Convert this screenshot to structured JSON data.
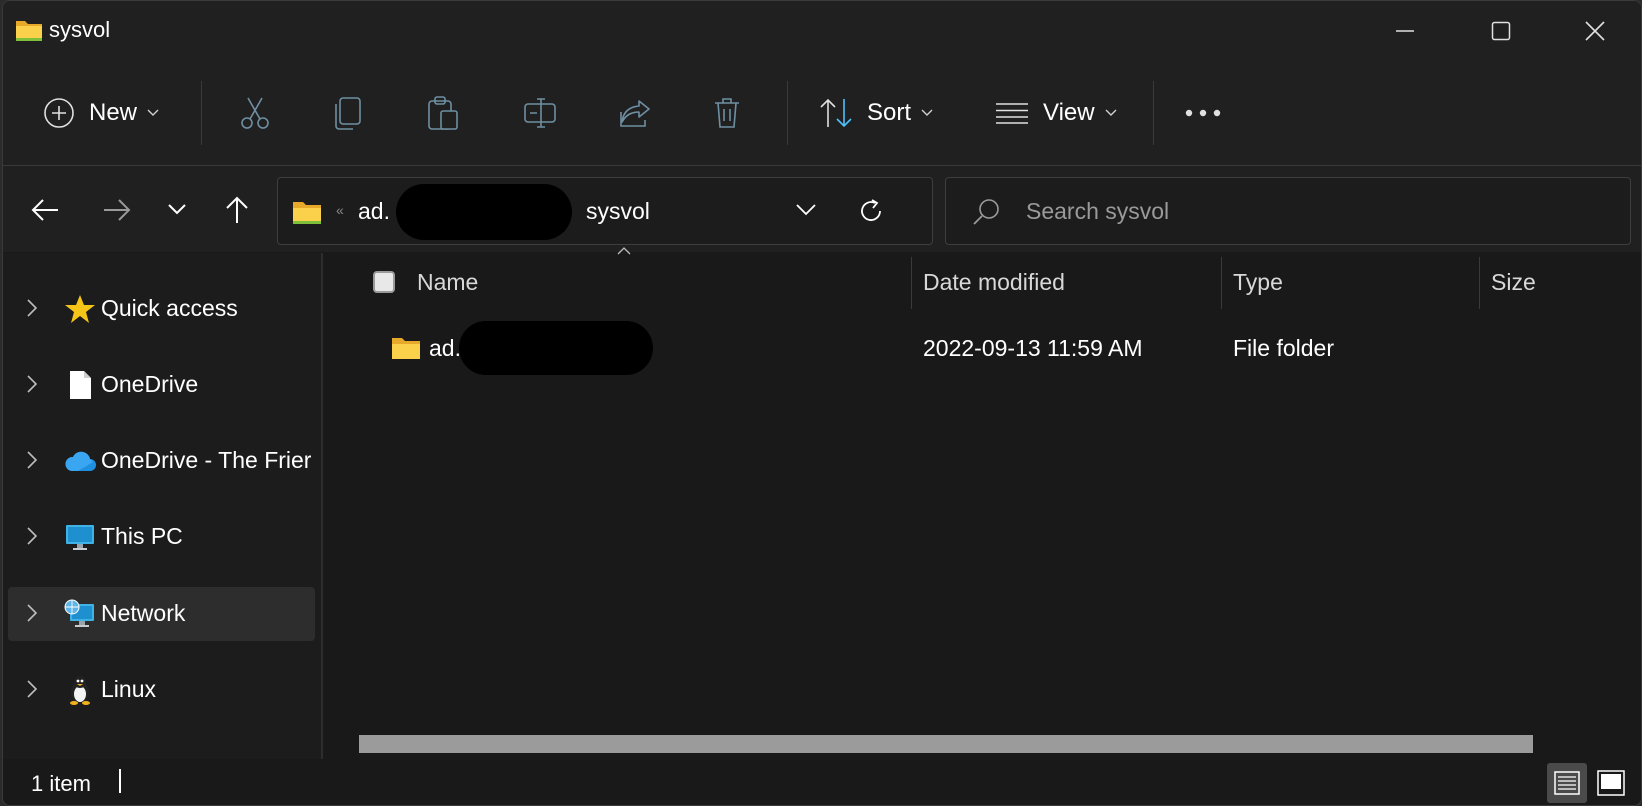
{
  "window": {
    "title": "sysvol",
    "controls": {
      "minimize": "minimize",
      "maximize": "maximize",
      "close": "close"
    }
  },
  "toolbar": {
    "new_label": "New",
    "sort_label": "Sort",
    "view_label": "View",
    "icons": [
      "plus-circle-icon",
      "cut-icon",
      "copy-icon",
      "paste-icon",
      "rename-icon",
      "share-icon",
      "delete-icon",
      "sort-icon",
      "view-icon",
      "more-icon"
    ]
  },
  "address": {
    "prefix": "ad.",
    "current": "sysvol",
    "separator": "«"
  },
  "search": {
    "placeholder": "Search sysvol"
  },
  "sidebar": {
    "items": [
      {
        "label": "Quick access",
        "icon": "star-icon"
      },
      {
        "label": "OneDrive",
        "icon": "document-icon"
      },
      {
        "label": "OneDrive - The Frier",
        "icon": "cloud-icon"
      },
      {
        "label": "This PC",
        "icon": "monitor-icon"
      },
      {
        "label": "Network",
        "icon": "network-icon",
        "selected": true
      },
      {
        "label": "Linux",
        "icon": "penguin-icon"
      }
    ]
  },
  "columns": {
    "name": "Name",
    "date": "Date modified",
    "type": "Type",
    "size": "Size"
  },
  "rows": [
    {
      "name": "ad.",
      "date": "2022-09-13 11:59 AM",
      "type": "File folder",
      "size": ""
    }
  ],
  "status": {
    "count": "1 item"
  },
  "colors": {
    "window_bg": "#191919",
    "chrome_bg": "#202020",
    "accent_blue": "#4cc2ff",
    "folder_yellow": "#f8c93e"
  }
}
